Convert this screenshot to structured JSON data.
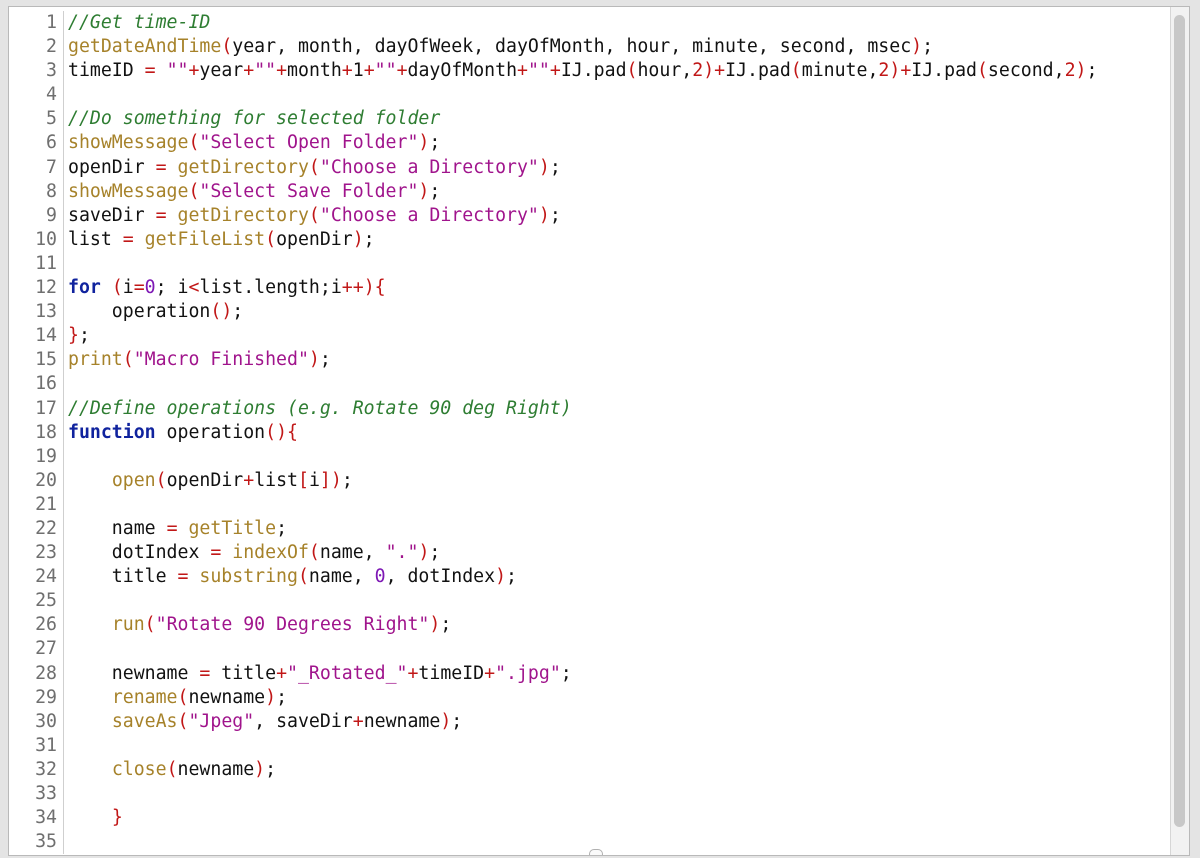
{
  "editor": {
    "language": "ImageJ macro",
    "colors": {
      "comment": "#2e7d32",
      "function": "#a6822a",
      "string": "#a0148c",
      "operator": "#c11717",
      "keyword": "#10239e",
      "number": "#7e18b5",
      "plain": "#111111"
    },
    "lines": [
      {
        "n": "1",
        "tokens": [
          [
            "c",
            "//Get time-ID"
          ]
        ]
      },
      {
        "n": "2",
        "tokens": [
          [
            "f",
            "getDateAndTime"
          ],
          [
            "o",
            "("
          ],
          [
            "p",
            "year, month, dayOfWeek, dayOfMonth, hour, minute, second, msec"
          ],
          [
            "o",
            ")"
          ],
          [
            "p",
            ";"
          ]
        ]
      },
      {
        "n": "3",
        "tokens": [
          [
            "p",
            "timeID "
          ],
          [
            "o",
            "="
          ],
          [
            "p",
            " "
          ],
          [
            "s",
            "\"\""
          ],
          [
            "o",
            "+"
          ],
          [
            "p",
            "year"
          ],
          [
            "o",
            "+"
          ],
          [
            "s",
            "\"\""
          ],
          [
            "o",
            "+"
          ],
          [
            "p",
            "month"
          ],
          [
            "o",
            "+"
          ],
          [
            "p",
            "1"
          ],
          [
            "o",
            "+"
          ],
          [
            "s",
            "\"\""
          ],
          [
            "o",
            "+"
          ],
          [
            "p",
            "dayOfMonth"
          ],
          [
            "o",
            "+"
          ],
          [
            "s",
            "\"\""
          ],
          [
            "o",
            "+"
          ],
          [
            "p",
            "IJ.pad"
          ],
          [
            "o",
            "("
          ],
          [
            "p",
            "hour,"
          ],
          [
            "o",
            "2"
          ],
          [
            "o",
            ")"
          ],
          [
            "o",
            "+"
          ],
          [
            "p",
            "IJ.pad"
          ],
          [
            "o",
            "("
          ],
          [
            "p",
            "minute,"
          ],
          [
            "o",
            "2"
          ],
          [
            "o",
            ")"
          ],
          [
            "o",
            "+"
          ],
          [
            "p",
            "IJ.pad"
          ],
          [
            "o",
            "("
          ],
          [
            "p",
            "second,"
          ],
          [
            "o",
            "2"
          ],
          [
            "o",
            ")"
          ],
          [
            "p",
            ";"
          ]
        ]
      },
      {
        "n": "4",
        "tokens": []
      },
      {
        "n": "5",
        "tokens": [
          [
            "c",
            "//Do something for selected folder"
          ]
        ]
      },
      {
        "n": "6",
        "tokens": [
          [
            "f",
            "showMessage"
          ],
          [
            "o",
            "("
          ],
          [
            "s",
            "\"Select Open Folder\""
          ],
          [
            "o",
            ")"
          ],
          [
            "p",
            ";"
          ]
        ]
      },
      {
        "n": "7",
        "tokens": [
          [
            "p",
            "openDir "
          ],
          [
            "o",
            "="
          ],
          [
            "p",
            " "
          ],
          [
            "f",
            "getDirectory"
          ],
          [
            "o",
            "("
          ],
          [
            "s",
            "\"Choose a Directory\""
          ],
          [
            "o",
            ")"
          ],
          [
            "p",
            ";"
          ]
        ]
      },
      {
        "n": "8",
        "tokens": [
          [
            "f",
            "showMessage"
          ],
          [
            "o",
            "("
          ],
          [
            "s",
            "\"Select Save Folder\""
          ],
          [
            "o",
            ")"
          ],
          [
            "p",
            ";"
          ]
        ]
      },
      {
        "n": "9",
        "tokens": [
          [
            "p",
            "saveDir "
          ],
          [
            "o",
            "="
          ],
          [
            "p",
            " "
          ],
          [
            "f",
            "getDirectory"
          ],
          [
            "o",
            "("
          ],
          [
            "s",
            "\"Choose a Directory\""
          ],
          [
            "o",
            ")"
          ],
          [
            "p",
            ";"
          ]
        ]
      },
      {
        "n": "10",
        "tokens": [
          [
            "p",
            "list "
          ],
          [
            "o",
            "="
          ],
          [
            "p",
            " "
          ],
          [
            "f",
            "getFileList"
          ],
          [
            "o",
            "("
          ],
          [
            "p",
            "openDir"
          ],
          [
            "o",
            ")"
          ],
          [
            "p",
            ";"
          ]
        ]
      },
      {
        "n": "11",
        "tokens": []
      },
      {
        "n": "12",
        "tokens": [
          [
            "k",
            "for"
          ],
          [
            "p",
            " "
          ],
          [
            "o",
            "("
          ],
          [
            "p",
            "i"
          ],
          [
            "o",
            "="
          ],
          [
            "n",
            "0"
          ],
          [
            "p",
            "; i"
          ],
          [
            "o",
            "<"
          ],
          [
            "p",
            "list.length;i"
          ],
          [
            "o",
            "++"
          ],
          [
            "o",
            ")"
          ],
          [
            "o",
            "{"
          ]
        ]
      },
      {
        "n": "13",
        "tokens": [
          [
            "p",
            "    operation"
          ],
          [
            "o",
            "("
          ],
          [
            "o",
            ")"
          ],
          [
            "p",
            ";"
          ]
        ]
      },
      {
        "n": "14",
        "tokens": [
          [
            "o",
            "}"
          ],
          [
            "p",
            ";"
          ]
        ]
      },
      {
        "n": "15",
        "tokens": [
          [
            "f",
            "print"
          ],
          [
            "o",
            "("
          ],
          [
            "s",
            "\"Macro Finished\""
          ],
          [
            "o",
            ")"
          ],
          [
            "p",
            ";"
          ]
        ]
      },
      {
        "n": "16",
        "tokens": []
      },
      {
        "n": "17",
        "tokens": [
          [
            "c",
            "//Define operations (e.g. Rotate 90 deg Right)"
          ]
        ]
      },
      {
        "n": "18",
        "tokens": [
          [
            "k",
            "function"
          ],
          [
            "p",
            " operation"
          ],
          [
            "o",
            "("
          ],
          [
            "o",
            ")"
          ],
          [
            "o",
            "{"
          ]
        ]
      },
      {
        "n": "19",
        "tokens": []
      },
      {
        "n": "20",
        "tokens": [
          [
            "p",
            "    "
          ],
          [
            "f",
            "open"
          ],
          [
            "o",
            "("
          ],
          [
            "p",
            "openDir"
          ],
          [
            "o",
            "+"
          ],
          [
            "p",
            "list"
          ],
          [
            "o",
            "["
          ],
          [
            "p",
            "i"
          ],
          [
            "o",
            "]"
          ],
          [
            "o",
            ")"
          ],
          [
            "p",
            ";"
          ]
        ]
      },
      {
        "n": "21",
        "tokens": []
      },
      {
        "n": "22",
        "tokens": [
          [
            "p",
            "    name "
          ],
          [
            "o",
            "="
          ],
          [
            "p",
            " "
          ],
          [
            "f",
            "getTitle"
          ],
          [
            "p",
            ";"
          ]
        ]
      },
      {
        "n": "23",
        "tokens": [
          [
            "p",
            "    dotIndex "
          ],
          [
            "o",
            "="
          ],
          [
            "p",
            " "
          ],
          [
            "f",
            "indexOf"
          ],
          [
            "o",
            "("
          ],
          [
            "p",
            "name, "
          ],
          [
            "s",
            "\".\""
          ],
          [
            "o",
            ")"
          ],
          [
            "p",
            ";"
          ]
        ]
      },
      {
        "n": "24",
        "tokens": [
          [
            "p",
            "    title "
          ],
          [
            "o",
            "="
          ],
          [
            "p",
            " "
          ],
          [
            "f",
            "substring"
          ],
          [
            "o",
            "("
          ],
          [
            "p",
            "name, "
          ],
          [
            "n",
            "0"
          ],
          [
            "p",
            ", dotIndex"
          ],
          [
            "o",
            ")"
          ],
          [
            "p",
            ";"
          ]
        ]
      },
      {
        "n": "25",
        "tokens": []
      },
      {
        "n": "26",
        "tokens": [
          [
            "p",
            "    "
          ],
          [
            "f",
            "run"
          ],
          [
            "o",
            "("
          ],
          [
            "s",
            "\"Rotate 90 Degrees Right\""
          ],
          [
            "o",
            ")"
          ],
          [
            "p",
            ";"
          ]
        ]
      },
      {
        "n": "27",
        "tokens": []
      },
      {
        "n": "28",
        "tokens": [
          [
            "p",
            "    newname "
          ],
          [
            "o",
            "="
          ],
          [
            "p",
            " title"
          ],
          [
            "o",
            "+"
          ],
          [
            "s",
            "\"_Rotated_\""
          ],
          [
            "o",
            "+"
          ],
          [
            "p",
            "timeID"
          ],
          [
            "o",
            "+"
          ],
          [
            "s",
            "\".jpg\""
          ],
          [
            "p",
            ";"
          ]
        ]
      },
      {
        "n": "29",
        "tokens": [
          [
            "p",
            "    "
          ],
          [
            "f",
            "rename"
          ],
          [
            "o",
            "("
          ],
          [
            "p",
            "newname"
          ],
          [
            "o",
            ")"
          ],
          [
            "p",
            ";"
          ]
        ]
      },
      {
        "n": "30",
        "tokens": [
          [
            "p",
            "    "
          ],
          [
            "f",
            "saveAs"
          ],
          [
            "o",
            "("
          ],
          [
            "s",
            "\"Jpeg\""
          ],
          [
            "p",
            ", saveDir"
          ],
          [
            "o",
            "+"
          ],
          [
            "p",
            "newname"
          ],
          [
            "o",
            ")"
          ],
          [
            "p",
            ";"
          ]
        ]
      },
      {
        "n": "31",
        "tokens": []
      },
      {
        "n": "32",
        "tokens": [
          [
            "p",
            "    "
          ],
          [
            "f",
            "close"
          ],
          [
            "o",
            "("
          ],
          [
            "p",
            "newname"
          ],
          [
            "o",
            ")"
          ],
          [
            "p",
            ";"
          ]
        ]
      },
      {
        "n": "33",
        "tokens": []
      },
      {
        "n": "34",
        "tokens": [
          [
            "p",
            "    "
          ],
          [
            "o",
            "}"
          ]
        ]
      },
      {
        "n": "35",
        "tokens": []
      }
    ]
  }
}
